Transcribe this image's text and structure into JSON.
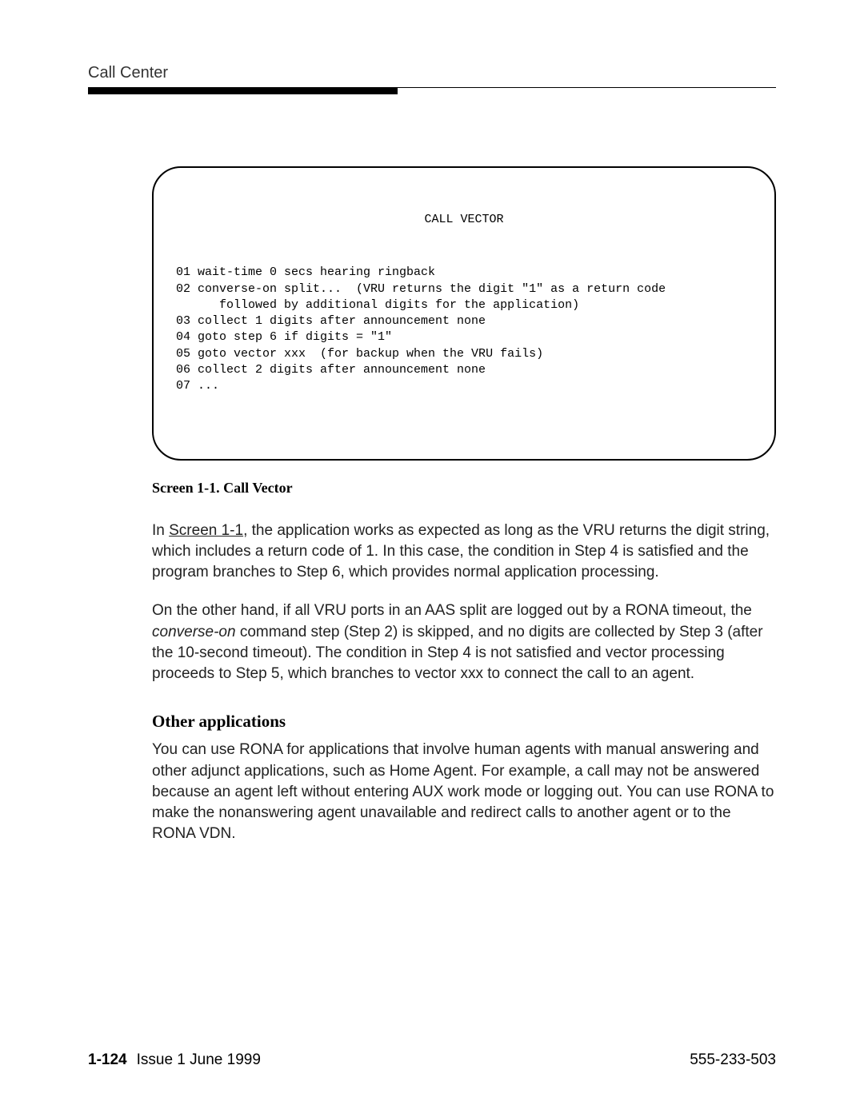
{
  "header": {
    "title": "Call Center"
  },
  "screen_box": {
    "title": "CALL VECTOR",
    "lines": "01 wait-time 0 secs hearing ringback\n02 converse-on split...  (VRU returns the digit \"1\" as a return code\n      followed by additional digits for the application)\n03 collect 1 digits after announcement none\n04 goto step 6 if digits = \"1\"\n05 goto vector xxx  (for backup when the VRU fails)\n06 collect 2 digits after announcement none\n07 ..."
  },
  "screen_caption": "Screen 1-1.   Call Vector",
  "para1": {
    "prefix": "In ",
    "ref": "Screen 1-1",
    "rest": ", the application works as expected as long as the VRU returns the digit string, which includes a return code of 1. In this case, the condition in Step 4 is satisfied and the program branches to Step 6, which provides normal application processing."
  },
  "para2": {
    "part1": "On the other hand, if all VRU ports in an AAS split are logged out by a RONA timeout, the ",
    "italic": "converse-on",
    "part2": " command step (Step 2) is skipped, and no digits are collected by Step 3 (after the 10-second timeout). The condition in Step 4 is not satisfied and vector processing proceeds to Step 5, which branches to vector xxx to connect the call to an agent."
  },
  "subheading": "Other applications",
  "para3": "You can use RONA for applications that involve human agents with manual answering and other adjunct applications, such as Home Agent. For example, a call may not be answered because an agent left without entering AUX work mode or logging out. You can use RONA to make the nonanswering agent unavailable and redirect calls to another agent or to the RONA VDN.",
  "footer": {
    "page_number": "1-124",
    "issue": "Issue 1 June 1999",
    "docnum": "555-233-503"
  }
}
